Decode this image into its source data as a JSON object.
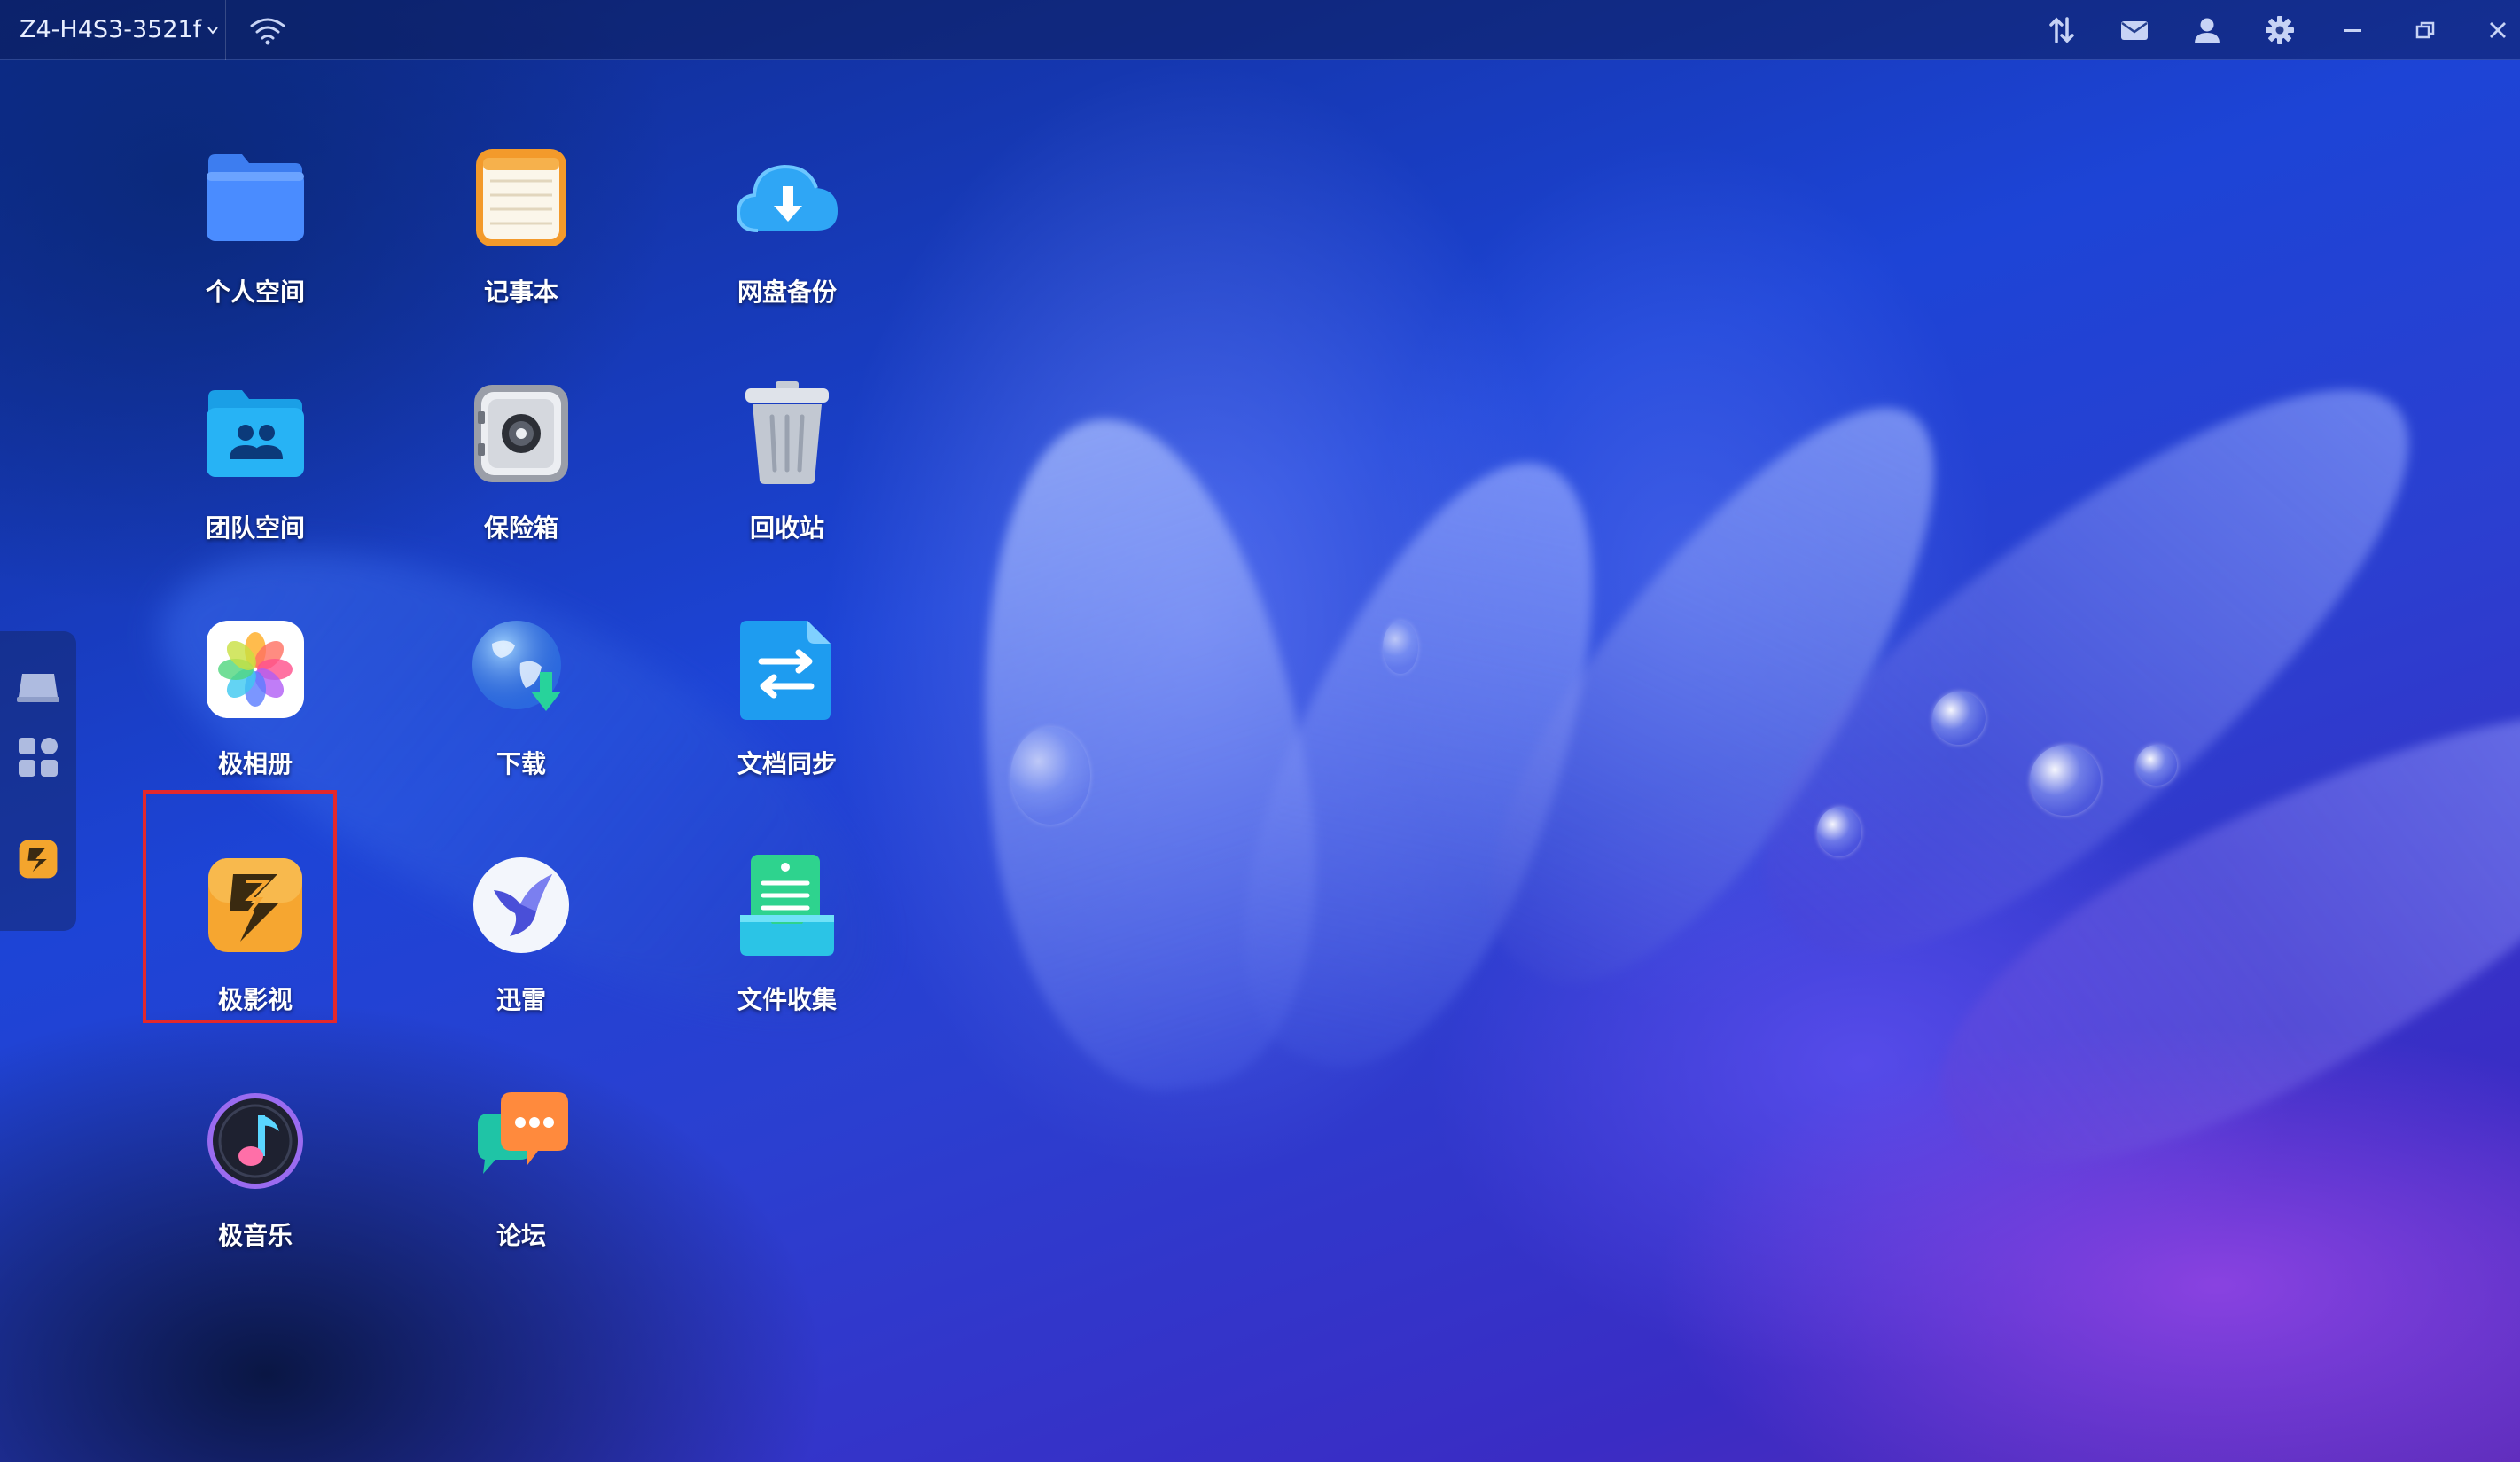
{
  "topbar": {
    "device_name": "Z4-H4S3-3521f",
    "right_icons": [
      "transfer-icon",
      "mail-icon",
      "user-icon",
      "settings-icon",
      "minimize-icon",
      "restore-icon",
      "close-icon"
    ]
  },
  "dock": {
    "items": [
      "desktop-icon",
      "apps-grid-icon",
      "jiyingshi-icon"
    ]
  },
  "desktop": {
    "apps": [
      {
        "label": "个人空间",
        "icon": "folder-icon"
      },
      {
        "label": "记事本",
        "icon": "notepad-icon"
      },
      {
        "label": "网盘备份",
        "icon": "cloud-download-icon"
      },
      {
        "label": "团队空间",
        "icon": "team-folder-icon"
      },
      {
        "label": "保险箱",
        "icon": "safe-icon"
      },
      {
        "label": "回收站",
        "icon": "trash-icon"
      },
      {
        "label": "极相册",
        "icon": "photos-icon"
      },
      {
        "label": "下载",
        "icon": "globe-download-icon"
      },
      {
        "label": "文档同步",
        "icon": "doc-sync-icon"
      },
      {
        "label": "极影视",
        "icon": "video-icon"
      },
      {
        "label": "迅雷",
        "icon": "thunder-bird-icon"
      },
      {
        "label": "文件收集",
        "icon": "file-collect-icon"
      },
      {
        "label": "极音乐",
        "icon": "music-icon"
      },
      {
        "label": "论坛",
        "icon": "forum-chat-icon"
      }
    ],
    "highlighted_app": "极影视",
    "highlight_color": "#e3282c"
  }
}
